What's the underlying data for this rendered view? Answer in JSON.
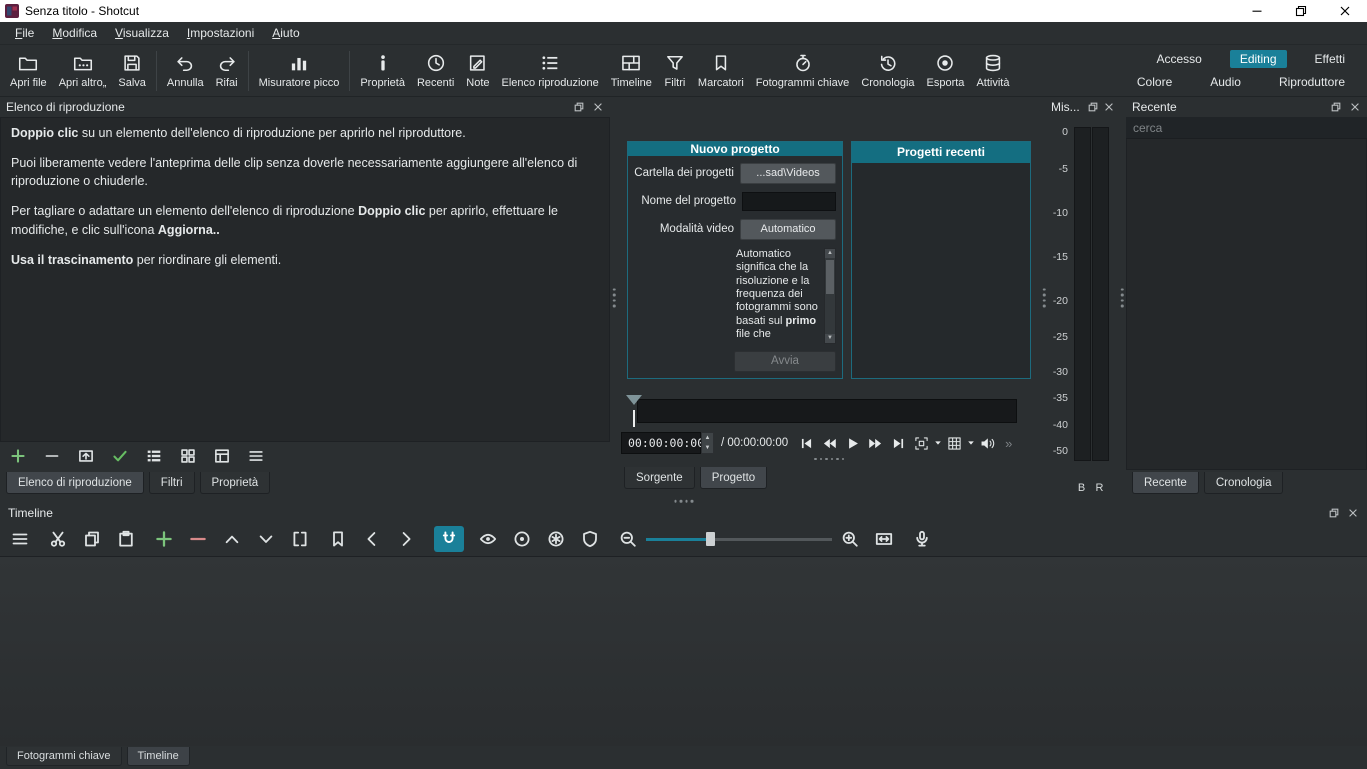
{
  "window": {
    "title": "Senza titolo - Shotcut"
  },
  "menu": {
    "items": [
      "File",
      "Modifica",
      "Visualizza",
      "Impostazioni",
      "Aiuto"
    ]
  },
  "toolbar": {
    "buttons": {
      "open_file": "Apri file",
      "open_other": "Apri altro„",
      "save": "Salva",
      "undo": "Annulla",
      "redo": "Rifai",
      "peak_meter": "Misuratore picco",
      "properties": "Proprietà",
      "recent": "Recenti",
      "notes": "Note",
      "playlist": "Elenco riproduzione",
      "timeline": "Timeline",
      "filters": "Filtri",
      "markers": "Marcatori",
      "keyframes": "Fotogrammi chiave",
      "history": "Cronologia",
      "export": "Esporta",
      "jobs": "Attività"
    },
    "layouts": {
      "row1": [
        "Accesso",
        "Editing",
        "Effetti"
      ],
      "row2": [
        "Colore",
        "Audio",
        "Riproduttore"
      ],
      "active": "Editing"
    }
  },
  "playlist": {
    "title": "Elenco di riproduzione",
    "tip1_bold": "Doppio clic",
    "tip1_rest": " su un elemento dell'elenco di riproduzione per aprirlo nel riproduttore.",
    "tip2": "Puoi liberamente vedere l'anteprima delle clip senza doverle necessariamente aggiungere all'elenco di riproduzione o chiuderle.",
    "tip3_pre": "Per tagliare o adattare un elemento dell'elenco di riproduzione ",
    "tip3_bold": "Doppio clic",
    "tip3_mid": " per aprirlo, effettuare le modifiche, e clic sull'icona ",
    "tip3_bold2": "Aggiorna..",
    "tip4_bold": "Usa il trascinamento",
    "tip4_rest": " per riordinare gli elementi.",
    "tabs": [
      "Elenco di riproduzione",
      "Filtri",
      "Proprietà"
    ]
  },
  "new_project": {
    "title": "Nuovo progetto",
    "folder_label": "Cartella dei progetti",
    "folder_value": "...sad\\Videos",
    "name_label": "Nome del progetto",
    "video_mode_label": "Modalità video",
    "video_mode_value": "Automatico",
    "help_pre": "Automatico significa che la risoluzione e la frequenza dei fotogrammi sono basati sul ",
    "help_bold": "primo",
    "help_tail": " file che",
    "start": "Avvia"
  },
  "recent_projects": {
    "title": "Progetti recenti"
  },
  "player": {
    "position": "00:00:00:00",
    "duration": "/ 00:00:00:00",
    "tabs": [
      "Sorgente",
      "Progetto"
    ],
    "overflow": "»"
  },
  "audio_meter": {
    "title": "Mis...",
    "scale": [
      "0",
      "-5",
      "-10",
      "-15",
      "-20",
      "-25",
      "-30",
      "-35",
      "-40",
      "-50"
    ],
    "channels": [
      "B",
      "R"
    ]
  },
  "recent_panel": {
    "title": "Recente",
    "search_placeholder": "cerca",
    "tabs": [
      "Recente",
      "Cronologia"
    ]
  },
  "timeline_panel": {
    "title": "Timeline"
  },
  "bottom_tabs": [
    "Fotogrammi chiave",
    "Timeline"
  ],
  "colors": {
    "accent": "#1a8099",
    "card_header": "#146e81"
  }
}
